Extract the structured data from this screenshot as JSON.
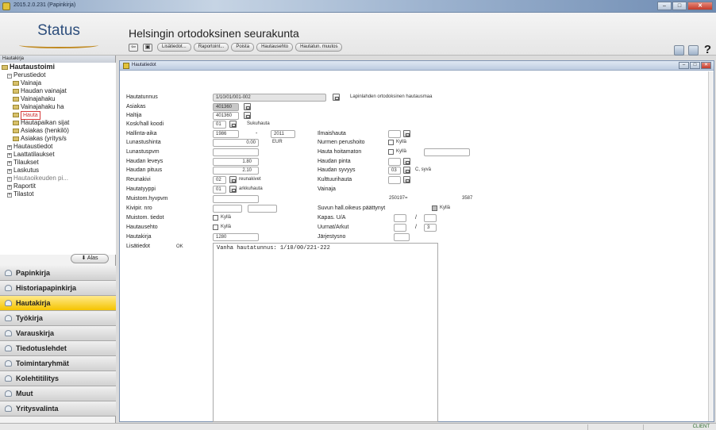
{
  "window": {
    "title": "2015.2.0.231 (Papinkirja)",
    "min": "–",
    "max": "□",
    "close": "✕"
  },
  "header": {
    "logo": "Status",
    "org_title": "Helsingin ortodoksinen seurakunta",
    "toolbar": {
      "buttons": [
        "Lisätiedot...",
        "Raportoint...",
        "Poista",
        "Hautausehto",
        "Hautatun. muutos"
      ]
    },
    "help": "?"
  },
  "left_panel": {
    "title": "Hautakirja",
    "tree": {
      "root": "Hautaustoimi",
      "perustiedot": "Perustiedot",
      "items": [
        "Vainaja",
        "Haudan vainajat",
        "Vainajahaku",
        "Vainajahaku ha",
        "Hauta",
        "Hautapaikan sijat",
        "Asiakas (henkilö)",
        "Asiakas (yritys/s"
      ],
      "groups": [
        "Hautaustiedot",
        "Laattatilaukset",
        "Tilaukset",
        "Laskutus",
        "Hautaoikeuden pi...",
        "Raportit",
        "Tilastot"
      ]
    },
    "alas_button": "Alas",
    "nav": [
      "Papinkirja",
      "Historiapapinkirja",
      "Hautakirja",
      "Työkirja",
      "Varauskirja",
      "Tiedotuslehdet",
      "Toimintaryhmät",
      "Kolehtitilitys",
      "Muut",
      "Yritysvalinta"
    ],
    "active_nav": "Hautakirja"
  },
  "main_window": {
    "title": "Hautatiedot",
    "form": {
      "hautatunnus": {
        "label": "Hautatunnus",
        "value": "1/10/01/001-002",
        "note": "Lapinlahden ortodoksinen hautausmaa"
      },
      "asiakas": {
        "label": "Asiakas",
        "value": "401360"
      },
      "haltija": {
        "label": "Haltija",
        "value": "401360"
      },
      "kosk_hall_koodi": {
        "label": "Kosk/hall koodi",
        "value": "01",
        "note": "Sukuhauta"
      },
      "hallinta_aika": {
        "label": "Hallinta-aika",
        "from": "1986",
        "dash": "-",
        "to": "2011"
      },
      "ilmaishauta": {
        "label": "Ilmaishauta"
      },
      "lunastushinta": {
        "label": "Lunastushinta",
        "value": "0.00",
        "unit": "EUR"
      },
      "nurmen_perushoito": {
        "label": "Nurmen perushoito",
        "check_label": "Kyllä"
      },
      "lunastuspvm": {
        "label": "Lunastuspvm"
      },
      "hauta_hoitamaton": {
        "label": "Hauta hoitamaton",
        "check_label": "Kyllä"
      },
      "haudan_leveys": {
        "label": "Haudan leveys",
        "value": "1.80"
      },
      "haudan_pinta": {
        "label": "Haudan pinta"
      },
      "haudan_pituus": {
        "label": "Haudan pituus",
        "value": "2.10"
      },
      "haudan_syvyys": {
        "label": "Haudan syvyys",
        "value": "03",
        "note": "C, syvä"
      },
      "reunakivi": {
        "label": "Reunakivi",
        "value": "02",
        "note": "reunakivet"
      },
      "kulttuurihauta": {
        "label": "Kulttuurihauta"
      },
      "hautatyyppi": {
        "label": "Hautatyyppi",
        "value": "01",
        "note": "arkkuhauta"
      },
      "vainaja": {
        "label": "Vainaja"
      },
      "muistom_hyvpvm": {
        "label": "Muistom.hyvpvm",
        "right_a": "250197=",
        "right_b": "3587"
      },
      "kivipir_nro": {
        "label": "Kivipir. nro"
      },
      "suvun_hall_oikeus": {
        "label": "Suvun hall.oikeus päättynyt",
        "check_label": "Kyllä"
      },
      "muistom_tiedot": {
        "label": "Muistom. tiedot",
        "check_label": "Kyllä"
      },
      "kapas_ua": {
        "label": "Kapas. U/A",
        "sep": "/"
      },
      "hautausehto": {
        "label": "Hautausehto",
        "check_label": "Kyllä"
      },
      "uurnat_arkut": {
        "label": "Uurnat/Arkut",
        "sep": "/",
        "value2": "3"
      },
      "hautakirja": {
        "label": "Hautakirja",
        "value": "1280"
      },
      "jarjestysno": {
        "label": "Järjestysno"
      },
      "lisatiedot": {
        "label": "Lisätiedot",
        "ok": "OK",
        "text": "Vanha hautatunnus: 1/10/00/221-222"
      }
    }
  },
  "statusbar": {
    "client": "CLIENT"
  }
}
